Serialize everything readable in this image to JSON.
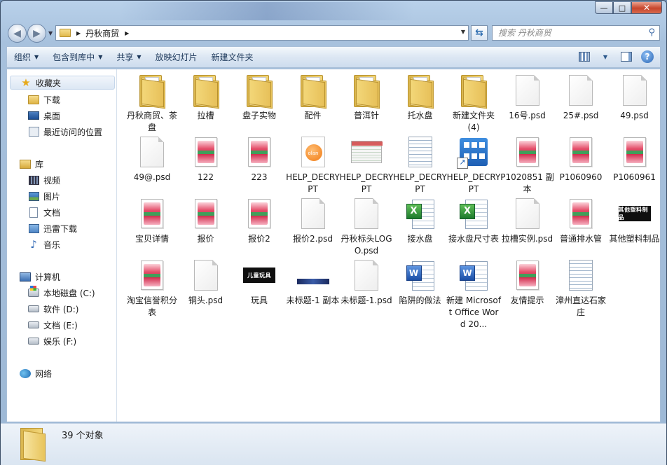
{
  "window": {
    "controls": {
      "minimize": "—",
      "maximize": "□",
      "close": "✕"
    }
  },
  "address": {
    "crumb": "丹秋商贸",
    "search_placeholder": "搜索 丹秋商贸"
  },
  "toolbar": {
    "organize": "组织",
    "include_library": "包含到库中",
    "share": "共享",
    "slideshow": "放映幻灯片",
    "new_folder": "新建文件夹"
  },
  "sidebar": {
    "favorites": "收藏夹",
    "downloads": "下载",
    "desktop": "桌面",
    "recent": "最近访问的位置",
    "libraries": "库",
    "videos": "视频",
    "pictures": "图片",
    "documents": "文档",
    "xunlei": "迅雷下载",
    "music": "音乐",
    "computer": "计算机",
    "drive_c": "本地磁盘 (C:)",
    "drive_d": "软件 (D:)",
    "drive_e": "文档 (E:)",
    "drive_f": "娱乐 (F:)",
    "network": "网络"
  },
  "files": [
    {
      "name": "丹秋商贸、茶盘",
      "icon": "folder-icon"
    },
    {
      "name": "拉槽",
      "icon": "folder-icon"
    },
    {
      "name": "盘子实物",
      "icon": "folder-icon"
    },
    {
      "name": "配件",
      "icon": "folder-icon"
    },
    {
      "name": "普洱针",
      "icon": "folder-icon"
    },
    {
      "name": "托水盘",
      "icon": "folder-icon"
    },
    {
      "name": "新建文件夹 (4)",
      "icon": "folder-icon"
    },
    {
      "name": "16号.psd",
      "icon": "psd-icon"
    },
    {
      "name": "25#.psd",
      "icon": "psd-icon"
    },
    {
      "name": "49.psd",
      "icon": "psd-icon"
    },
    {
      "name": "49@.psd",
      "icon": "psd-icon"
    },
    {
      "name": "122",
      "icon": "image-thumbnail-icon"
    },
    {
      "name": "223",
      "icon": "image-thumbnail-icon"
    },
    {
      "name": "HELP_DECRYPT",
      "icon": "orange-image-icon"
    },
    {
      "name": "HELP_DECRYPT",
      "icon": "screenshot-icon"
    },
    {
      "name": "HELP_DECRYPT",
      "icon": "text-file-icon"
    },
    {
      "name": "HELP_DECRYPT",
      "icon": "shortcut-icon"
    },
    {
      "name": "P1020851 副本",
      "icon": "image-thumbnail-icon"
    },
    {
      "name": "P1060960",
      "icon": "image-thumbnail-icon"
    },
    {
      "name": "P1060961",
      "icon": "image-thumbnail-icon"
    },
    {
      "name": "宝贝详情",
      "icon": "image-thumbnail-icon"
    },
    {
      "name": "报价",
      "icon": "image-thumbnail-icon"
    },
    {
      "name": "报价2",
      "icon": "image-thumbnail-icon"
    },
    {
      "name": "报价2.psd",
      "icon": "psd-icon"
    },
    {
      "name": "丹秋标头LOGO.psd",
      "icon": "psd-icon"
    },
    {
      "name": "接水盘",
      "icon": "excel-icon"
    },
    {
      "name": "接水盘尺寸表",
      "icon": "excel-icon"
    },
    {
      "name": "拉槽实例.psd",
      "icon": "psd-icon"
    },
    {
      "name": "普通排水管",
      "icon": "image-thumbnail-icon"
    },
    {
      "name": "其他塑料制品",
      "icon": "banner-icon",
      "banner_text": "其他塑料制品"
    },
    {
      "name": "淘宝信誉积分表",
      "icon": "image-thumbnail-icon"
    },
    {
      "name": "铜头.psd",
      "icon": "psd-icon"
    },
    {
      "name": "玩具",
      "icon": "banner-icon",
      "banner_text": "儿童玩具"
    },
    {
      "name": "未标题-1 副本",
      "icon": "strip-icon"
    },
    {
      "name": "未标题-1.psd",
      "icon": "psd-icon"
    },
    {
      "name": "陷阱的做法",
      "icon": "word-icon"
    },
    {
      "name": "新建 Microsoft Office Word 20...",
      "icon": "word-icon"
    },
    {
      "name": "友情提示",
      "icon": "image-thumbnail-icon"
    },
    {
      "name": "漳州直达石家庄",
      "icon": "text-file-icon"
    }
  ],
  "status": {
    "count": "39 个对象"
  },
  "colors": {
    "window_frame": "#b9d1ea",
    "toolbar_text": "#1e395b",
    "selection": "#dce7f4"
  }
}
